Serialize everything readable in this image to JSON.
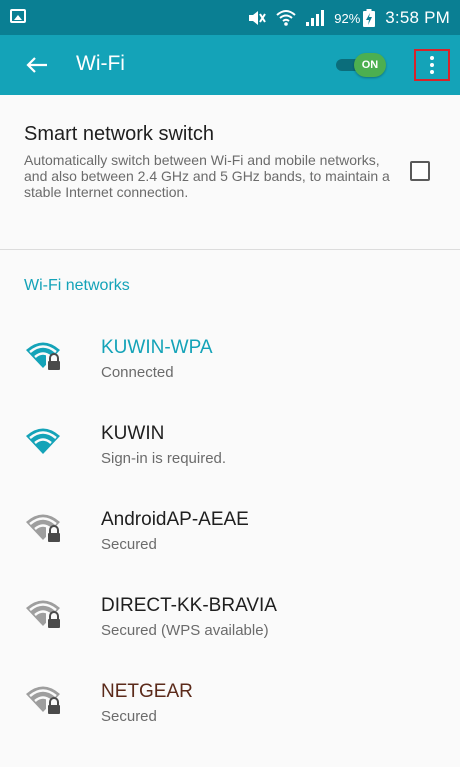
{
  "statusbar": {
    "battery": "92%",
    "time": "3:58 PM",
    "icons": [
      "gallery-icon",
      "mute-icon",
      "wifi-icon",
      "signal-icon",
      "battery-icon"
    ]
  },
  "appbar": {
    "title": "Wi-Fi",
    "toggle_label": "ON",
    "toggle_on": true,
    "colors": {
      "bar": "#14a3b8",
      "status": "#0a7f93",
      "toggle": "#4caf50"
    }
  },
  "smart_switch": {
    "title": "Smart network switch",
    "description": "Automatically switch between Wi-Fi and mobile networks, and also between 2.4 GHz and 5 GHz bands, to maintain a stable Internet connection.",
    "checked": false
  },
  "networks_header": "Wi-Fi networks",
  "networks": [
    {
      "name": "KUWIN-WPA",
      "status": "Connected",
      "name_color": "#14a3b8",
      "signal_color": "#14a3b8",
      "locked": true
    },
    {
      "name": "KUWIN",
      "status": "Sign-in is required.",
      "name_color": "#1f1f1f",
      "signal_color": "#14a3b8",
      "locked": false
    },
    {
      "name": "AndroidAP-AEAE",
      "status": "Secured",
      "name_color": "#1f1f1f",
      "signal_color": "#9e9e9e",
      "locked": true
    },
    {
      "name": "DIRECT-KK-BRAVIA",
      "status": "Secured (WPS available)",
      "name_color": "#1f1f1f",
      "signal_color": "#9e9e9e",
      "locked": true
    },
    {
      "name": "NETGEAR",
      "status": "Secured",
      "name_color": "#5b2a1a",
      "signal_color": "#9e9e9e",
      "locked": true
    }
  ]
}
